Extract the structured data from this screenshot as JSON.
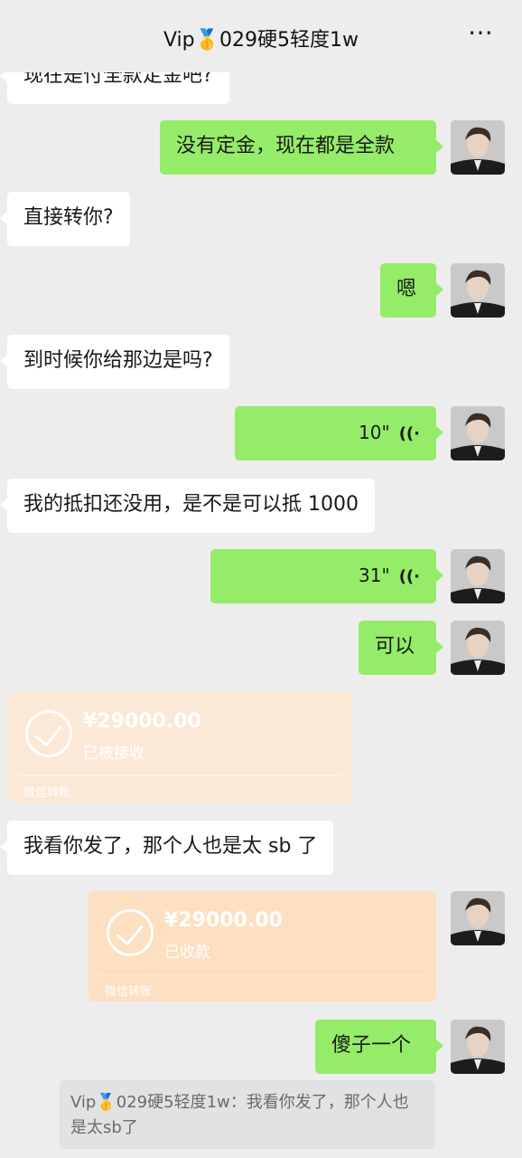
{
  "header": {
    "title": "Vip🥇029硬5轻度1w",
    "more_icon": "⋯"
  },
  "messages": {
    "m1": "现在是付全款定金吧?",
    "m2": "没有定金，现在都是全款",
    "m3": "直接转你?",
    "m4": "嗯",
    "m5": "到时候你给那边是吗?",
    "m6_voice": "10\"",
    "m7": "我的抵扣还没用，是不是可以抵 1000",
    "m8_voice": "31\"",
    "m9": "可以",
    "m11": "我看你发了，那个人也是太 sb 了",
    "m13": "傻子一个"
  },
  "voice_icon": "((·",
  "transfer_received": {
    "amount": "¥29000.00",
    "status": "已被接收",
    "footer": "微信转账"
  },
  "transfer_sent": {
    "amount": "¥29000.00",
    "status": "已收款",
    "footer": "微信转账"
  },
  "quote": {
    "text": "Vip🥇029硬5轻度1w：我看你发了，那个人也是太sb了"
  },
  "colors": {
    "self_bubble": "#95ec69",
    "other_bubble": "#ffffff",
    "background": "#ededed",
    "transfer": "#fddfc2"
  }
}
